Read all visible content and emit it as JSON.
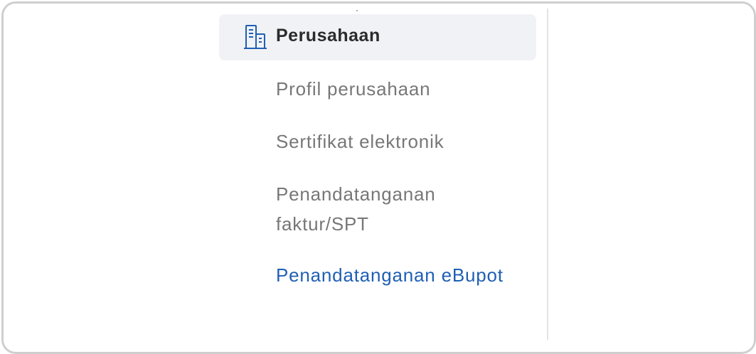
{
  "section": {
    "title": "Perusahaan",
    "icon": "building-icon"
  },
  "menu": {
    "items": [
      {
        "label": "Profil perusahaan",
        "active": false
      },
      {
        "label": "Sertifikat elektronik",
        "active": false
      },
      {
        "label": "Penandatanganan faktur/SPT",
        "active": false
      },
      {
        "label": "Penandatanganan eBupot",
        "active": true
      }
    ]
  },
  "colors": {
    "accent": "#1f5fb4",
    "muted_text": "#777777",
    "header_bg": "#f1f2f5"
  }
}
